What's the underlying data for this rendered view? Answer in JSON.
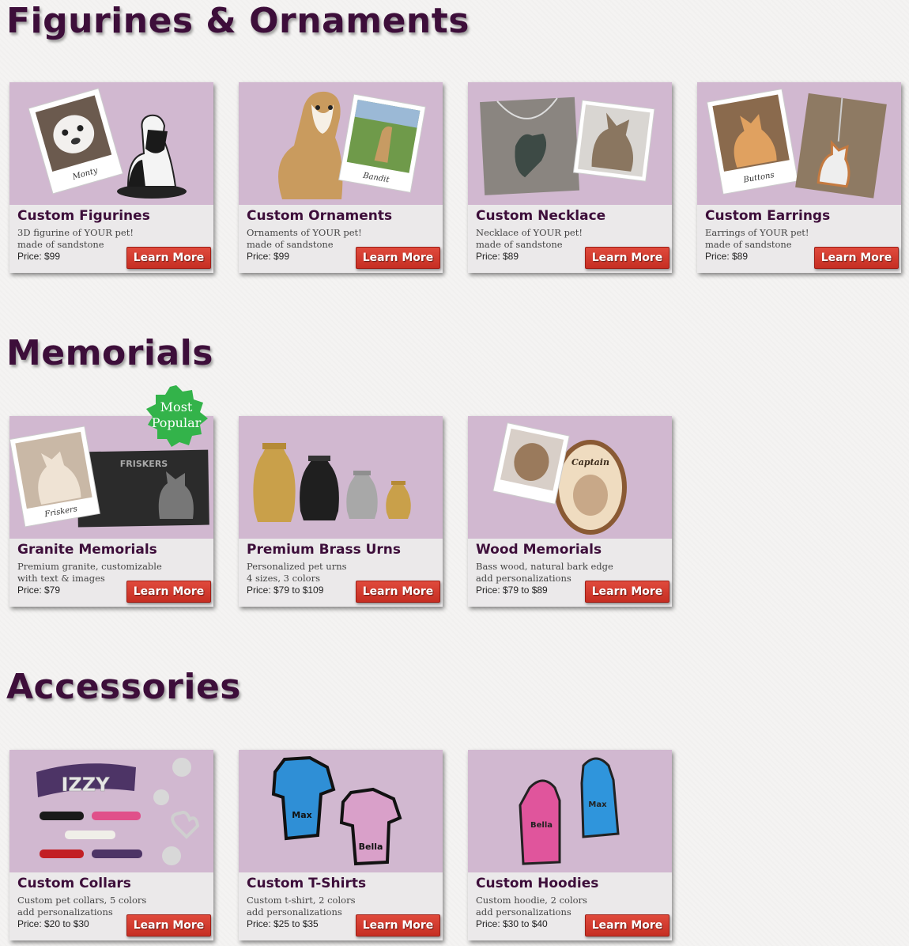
{
  "sections": [
    {
      "title": "Figurines & Ornaments",
      "cards": [
        {
          "title": "Custom Figurines",
          "desc1": "3D figurine of YOUR pet!",
          "desc2": "made of sandstone",
          "price": "Price: $99",
          "button": "Learn More",
          "photo_caption": "Monty",
          "image": "figurine-image"
        },
        {
          "title": "Custom Ornaments",
          "desc1": "Ornaments of YOUR pet!",
          "desc2": "made of sandstone",
          "price": "Price: $99",
          "button": "Learn More",
          "photo_caption": "Bandit",
          "image": "ornament-image"
        },
        {
          "title": "Custom Necklace",
          "desc1": "Necklace of YOUR pet!",
          "desc2": "made of sandstone",
          "price": "Price: $89",
          "button": "Learn More",
          "image": "necklace-image"
        },
        {
          "title": "Custom Earrings",
          "desc1": "Earrings of YOUR pet!",
          "desc2": "made of sandstone",
          "price": "Price: $89",
          "button": "Learn More",
          "photo_caption": "Buttons",
          "image": "earrings-image"
        }
      ]
    },
    {
      "title": "Memorials",
      "badge": "Most Popular",
      "badge_line1": "Most",
      "badge_line2": "Popular",
      "cards": [
        {
          "title": "Granite Memorials",
          "desc1": "Premium granite, customizable",
          "desc2": "with text & images",
          "price": "Price: $79",
          "button": "Learn More",
          "photo_caption": "Friskers",
          "plaque_text": "FRISKERS",
          "image": "granite-image"
        },
        {
          "title": "Premium Brass Urns",
          "desc1": "Personalized pet urns",
          "desc2": "4 sizes, 3 colors",
          "price": "Price: $79 to $109",
          "button": "Learn More",
          "image": "urns-image"
        },
        {
          "title": "Wood Memorials",
          "desc1": "Bass wood, natural bark edge",
          "desc2": "add personalizations",
          "price": "Price: $79 to $89",
          "button": "Learn More",
          "plaque_text": "Captain",
          "image": "wood-image"
        }
      ]
    },
    {
      "title": "Accessories",
      "cards": [
        {
          "title": "Custom Collars",
          "desc1": "Custom pet collars, 5 colors",
          "desc2": "add personalizations",
          "price": "Price: $20 to $30",
          "button": "Learn More",
          "collar_text": "IZZY",
          "image": "collars-image"
        },
        {
          "title": "Custom T-Shirts",
          "desc1": "Custom t-shirt, 2 colors",
          "desc2": "add personalizations",
          "price": "Price: $25 to $35",
          "button": "Learn More",
          "name1": "Max",
          "name2": "Bella",
          "image": "tshirts-image"
        },
        {
          "title": "Custom Hoodies",
          "desc1": "Custom hoodie, 2 colors",
          "desc2": "add personalizations",
          "price": "Price: $30 to $40",
          "button": "Learn More",
          "name1": "Bella",
          "name2": "Max",
          "image": "hoodies-image"
        }
      ]
    }
  ],
  "colors": {
    "heading": "#3d0e3a",
    "image_bg": "#d1b8d0",
    "card_bg": "#ebe9ea",
    "button": "#d43a2e",
    "badge": "#33b34a"
  }
}
